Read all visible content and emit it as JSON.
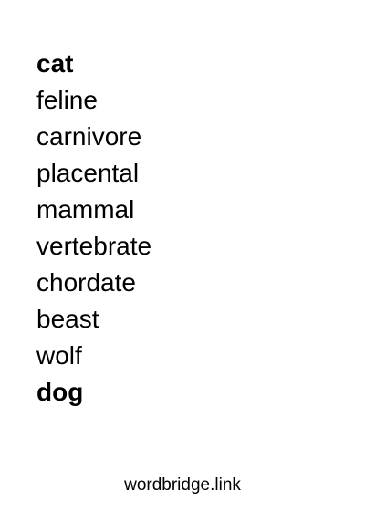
{
  "chain": {
    "start_word": "cat",
    "intermediate_words": [
      "feline",
      "carnivore",
      "placental",
      "mammal",
      "vertebrate",
      "chordate",
      "beast",
      "wolf"
    ],
    "end_word": "dog"
  },
  "footer": {
    "site": "wordbridge.link"
  }
}
